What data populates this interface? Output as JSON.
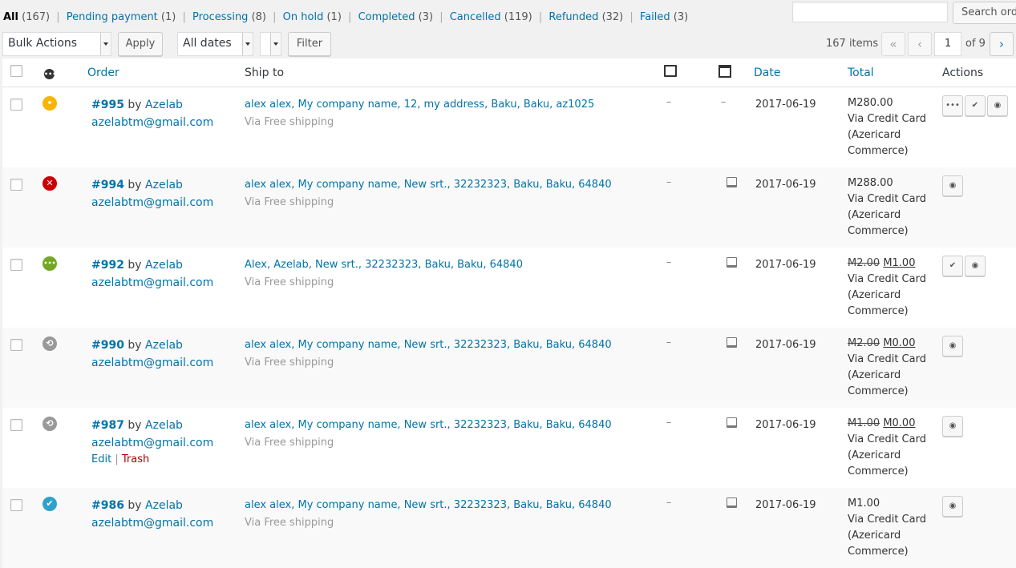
{
  "filters": {
    "all": {
      "label": "All",
      "count": "(167)"
    },
    "links": [
      {
        "label": "Pending payment",
        "count": "(1)"
      },
      {
        "label": "Processing",
        "count": "(8)"
      },
      {
        "label": "On hold",
        "count": "(1)"
      },
      {
        "label": "Completed",
        "count": "(3)"
      },
      {
        "label": "Cancelled",
        "count": "(119)"
      },
      {
        "label": "Refunded",
        "count": "(32)"
      },
      {
        "label": "Failed",
        "count": "(3)"
      }
    ],
    "separator": "|"
  },
  "search": {
    "placeholder": "",
    "button": "Search orders"
  },
  "toolbar": {
    "bulk_actions": "Bulk Actions",
    "apply": "Apply",
    "dates": "All dates",
    "filter": "Filter"
  },
  "pagination": {
    "items": "167 items",
    "first": "«",
    "prev": "‹",
    "current": "1",
    "of": "of 9",
    "next": "›"
  },
  "table": {
    "headers": {
      "order": "Order",
      "ship_to": "Ship to",
      "date": "Date",
      "total": "Total",
      "actions": "Actions"
    },
    "rows": [
      {
        "status": "on-hold",
        "status_color": "#f8b500",
        "order": "#995",
        "by": "by",
        "customer": "Azelab",
        "email": "azelabtm@gmail.com",
        "address": "alex alex, My company name, 12, my address, Baku, Baku, az1025",
        "via": "Via Free shipping",
        "billing": "–",
        "shipping": "–",
        "date": "2017-06-19",
        "total_old": "",
        "total": "M280.00",
        "payment": "Via Credit Card (Azericard Commerce)",
        "actions": [
          "processing",
          "complete",
          "view"
        ]
      },
      {
        "status": "failed",
        "status_color": "#cc0000",
        "order": "#994",
        "by": "by",
        "customer": "Azelab",
        "email": "azelabtm@gmail.com",
        "address": "alex alex, My company name, New srt., 32232323, Baku, Baku, 64840",
        "via": "Via Free shipping",
        "billing": "–",
        "shipping": "icon",
        "date": "2017-06-19",
        "total_old": "",
        "total": "M288.00",
        "payment": "Via Credit Card (Azericard Commerce)",
        "actions": [
          "view"
        ]
      },
      {
        "status": "processing",
        "status_color": "#73a724",
        "order": "#992",
        "by": "by",
        "customer": "Azelab",
        "email": "azelabtm@gmail.com",
        "address": "Alex, Azelab, New srt., 32232323, Baku, Baku, 64840",
        "via": "Via Free shipping",
        "billing": "–",
        "shipping": "icon",
        "date": "2017-06-19",
        "total_old": "M2.00",
        "total": "M1.00",
        "payment": "Via Credit Card (Azericard Commerce)",
        "actions": [
          "complete",
          "view"
        ]
      },
      {
        "status": "refunded",
        "status_color": "#999999",
        "order": "#990",
        "by": "by",
        "customer": "Azelab",
        "email": "azelabtm@gmail.com",
        "address": "alex alex, My company name, New srt., 32232323, Baku, Baku, 64840",
        "via": "Via Free shipping",
        "billing": "–",
        "shipping": "icon",
        "date": "2017-06-19",
        "total_old": "M2.00",
        "total": "M0.00",
        "payment": "Via Credit Card (Azericard Commerce)",
        "actions": [
          "view"
        ]
      },
      {
        "status": "refunded",
        "status_color": "#999999",
        "order": "#987",
        "by": "by",
        "customer": "Azelab",
        "email": "azelabtm@gmail.com",
        "row_actions": {
          "edit": "Edit",
          "sep": "|",
          "trash": "Trash"
        },
        "address": "alex alex, My company name, New srt., 32232323, Baku, Baku, 64840",
        "via": "Via Free shipping",
        "billing": "–",
        "shipping": "icon",
        "date": "2017-06-19",
        "total_old": "M1.00",
        "total": "M0.00",
        "payment": "Via Credit Card (Azericard Commerce)",
        "actions": [
          "view"
        ]
      },
      {
        "status": "completed",
        "status_color": "#2ea2cc",
        "order": "#986",
        "by": "by",
        "customer": "Azelab",
        "email": "azelabtm@gmail.com",
        "address": "alex alex, My company name, New srt., 32232323, Baku, Baku, 64840",
        "via": "Via Free shipping",
        "billing": "–",
        "shipping": "icon",
        "date": "2017-06-19",
        "total_old": "",
        "total": "M1.00",
        "payment": "Via Credit Card (Azericard Commerce)",
        "actions": [
          "view"
        ]
      }
    ]
  }
}
